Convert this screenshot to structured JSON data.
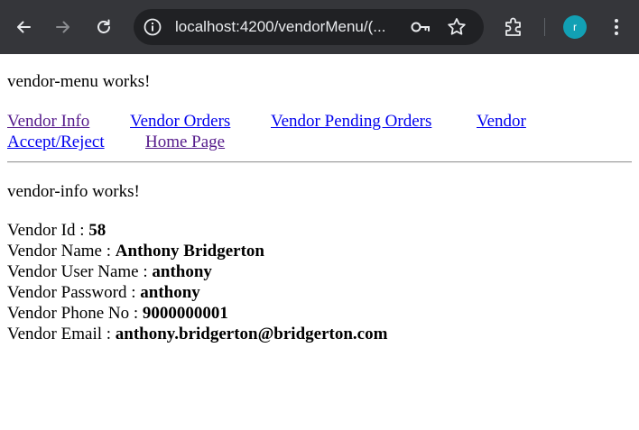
{
  "browser": {
    "url": "localhost:4200/vendorMenu/(...",
    "profile_initial": "r",
    "profile_color": "#12a0b4"
  },
  "page": {
    "menu_heading": "vendor-menu works!",
    "nav_links": [
      "Vendor Info",
      "Vendor Orders",
      "Vendor Pending Orders",
      "Vendor",
      "Accept/Reject",
      "Home Page"
    ],
    "info_heading": "vendor-info works!",
    "fields": [
      {
        "label": "Vendor Id : ",
        "value": "58"
      },
      {
        "label": "Vendor Name : ",
        "value": "Anthony Bridgerton"
      },
      {
        "label": "Vendor User Name : ",
        "value": "anthony"
      },
      {
        "label": "Vendor Password : ",
        "value": "anthony"
      },
      {
        "label": "Vendor Phone No : ",
        "value": "9000000001"
      },
      {
        "label": "Vendor Email : ",
        "value": "anthony.bridgerton@bridgerton.com"
      }
    ]
  },
  "colors": {
    "link": "#0000ee",
    "visited_link": "#551a8b",
    "chrome_bg": "#35363a",
    "omnibox_bg": "#202124"
  }
}
